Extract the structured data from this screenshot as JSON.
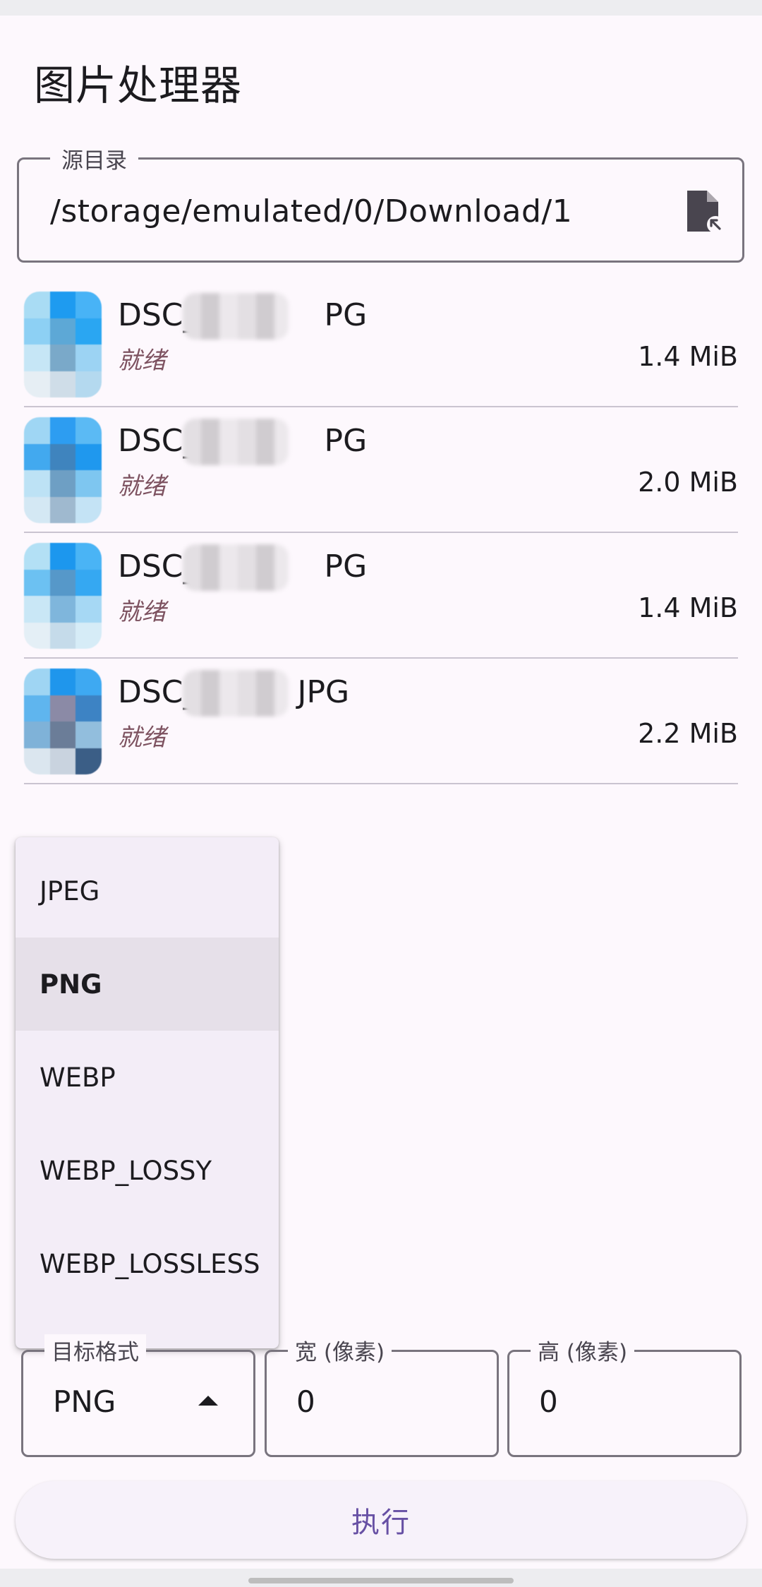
{
  "app": {
    "title": "图片处理器"
  },
  "source_dir": {
    "label": "源目录",
    "value": "/storage/emulated/0/Download/1",
    "icon": "file-picker-icon"
  },
  "files": [
    {
      "name_prefix": "DSC_",
      "name_suffix": "PG",
      "status": "就绪",
      "size": "1.4 MiB"
    },
    {
      "name_prefix": "DSC_",
      "name_suffix": "PG",
      "status": "就绪",
      "size": "2.0 MiB"
    },
    {
      "name_prefix": "DSC_",
      "name_suffix": "PG",
      "status": "就绪",
      "size": "1.4 MiB"
    },
    {
      "name_prefix": "DSC_",
      "name_suffix": "JPG",
      "status": "就绪",
      "size": "2.2 MiB"
    }
  ],
  "format_menu": {
    "options": [
      "JPEG",
      "PNG",
      "WEBP",
      "WEBP_LOSSY",
      "WEBP_LOSSLESS"
    ],
    "selected": "PNG"
  },
  "target_format": {
    "label": "目标格式",
    "value": "PNG"
  },
  "width": {
    "label": "宽 (像素)",
    "value": "0"
  },
  "height": {
    "label": "高 (像素)",
    "value": "0"
  },
  "execute": {
    "label": "执行"
  },
  "colors": {
    "accent": "#6750a4",
    "status": "#7d5260",
    "outline": "#79747e",
    "menu_bg": "#f3edf7",
    "menu_selected": "#e6e0e9"
  }
}
